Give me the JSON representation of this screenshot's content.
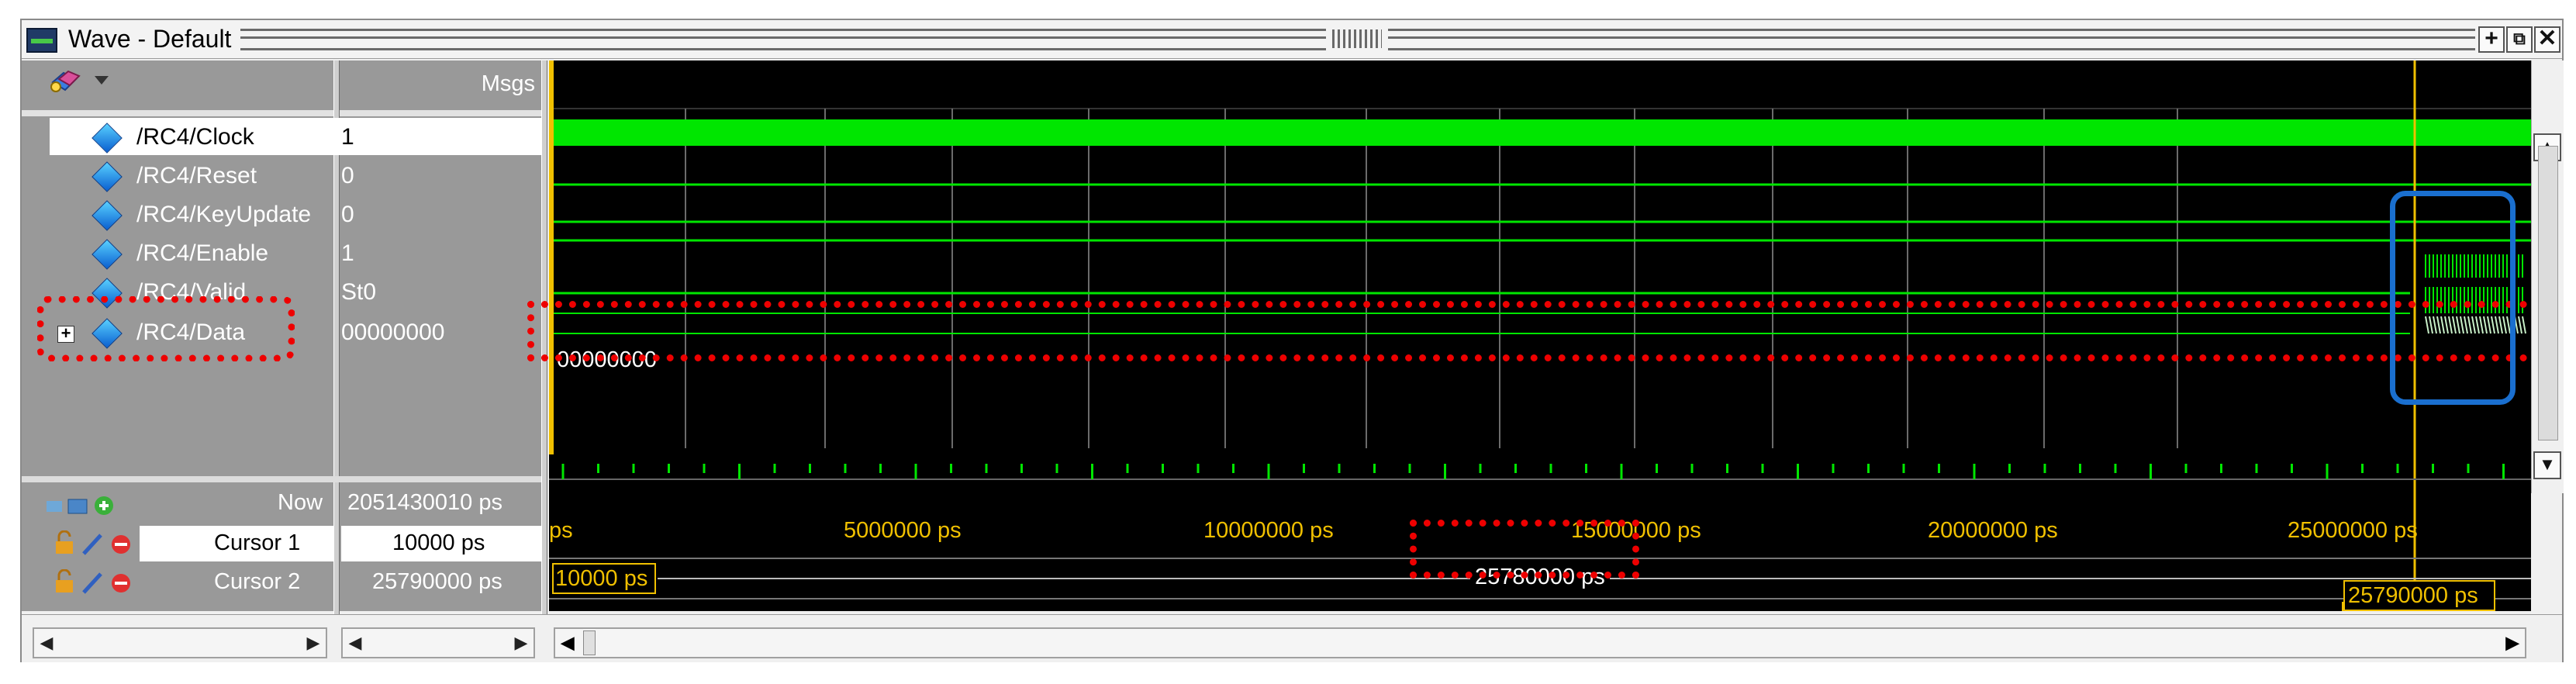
{
  "window": {
    "title": "Wave - Default"
  },
  "header": {
    "msgs_label": "Msgs"
  },
  "signals": [
    {
      "name": "/RC4/Clock",
      "value": "1",
      "expandable": false
    },
    {
      "name": "/RC4/Reset",
      "value": "0",
      "expandable": false
    },
    {
      "name": "/RC4/KeyUpdate",
      "value": "0",
      "expandable": false
    },
    {
      "name": "/RC4/Enable",
      "value": "1",
      "expandable": false
    },
    {
      "name": "/RC4/Valid",
      "value": "St0",
      "expandable": false
    },
    {
      "name": "/RC4/Data",
      "value": "00000000",
      "expandable": true
    }
  ],
  "wave": {
    "data_bus_value": "00000000"
  },
  "timeline": {
    "now_label": "Now",
    "now_value": "2051430010 ps",
    "ticks": [
      "ps",
      "5000000 ps",
      "10000000 ps",
      "15000000 ps",
      "20000000 ps",
      "25000000 ps"
    ]
  },
  "cursors": [
    {
      "label": "Cursor 1",
      "value": "10000 ps",
      "marker": "10000 ps"
    },
    {
      "label": "Cursor 2",
      "value": "25790000 ps",
      "marker": "25790000 ps"
    }
  ],
  "cursor_delta": "25780000 ps",
  "colors": {
    "waveform": "#00e600",
    "cursor": "#f0c000",
    "bus_tick": "#c8f0c8",
    "highlight": "#e00000",
    "box": "#1a6fcf"
  }
}
